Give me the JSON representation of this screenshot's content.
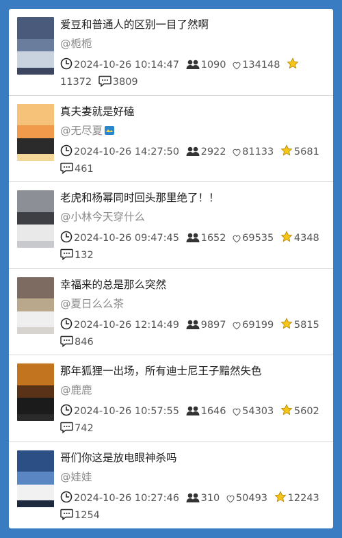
{
  "posts": [
    {
      "title": "爱豆和普通人的区别一目了然啊",
      "author": "@栀栀",
      "time": "2024-10-26 10:14:47",
      "views": "1090",
      "likes": "134148",
      "stars": "11372",
      "comments": "3809",
      "thumb_colors": [
        "#4a5a7a",
        "#6b7d9c",
        "#c9d3e0",
        "#3c4660"
      ]
    },
    {
      "title": "真夫妻就是好磕",
      "author": "@无尽夏",
      "author_badge": true,
      "time": "2024-10-26 14:27:50",
      "views": "2922",
      "likes": "81133",
      "stars": "5681",
      "comments": "461",
      "thumb_colors": [
        "#f6c27a",
        "#f29a4c",
        "#2b2b2b",
        "#f5d79a"
      ]
    },
    {
      "title": "老虎和杨幂同时回头那里绝了！！",
      "author": "@小林今天穿什么",
      "time": "2024-10-26 09:47:45",
      "views": "1652",
      "likes": "69535",
      "stars": "4348",
      "comments": "132",
      "thumb_colors": [
        "#8c8f96",
        "#3d3f45",
        "#e9e9ea",
        "#c7c9cd"
      ]
    },
    {
      "title": "幸福来的总是那么突然",
      "author": "@夏日么么茶",
      "time": "2024-10-26 12:14:49",
      "views": "9897",
      "likes": "69199",
      "stars": "5815",
      "comments": "846",
      "thumb_colors": [
        "#7d6a60",
        "#b9a88c",
        "#efefef",
        "#d7d3cf"
      ]
    },
    {
      "title": "那年狐狸一出场，所有迪士尼王子黯然失色",
      "author": "@鹿鹿",
      "time": "2024-10-26 10:57:55",
      "views": "1646",
      "likes": "54303",
      "stars": "5602",
      "comments": "742",
      "thumb_colors": [
        "#c3741f",
        "#5a3217",
        "#1b1b1b",
        "#2a2a2a"
      ]
    },
    {
      "title": "哥们你这是放电眼神杀吗",
      "author": "@娃娃",
      "time": "2024-10-26 10:27:46",
      "views": "310",
      "likes": "50493",
      "stars": "12243",
      "comments": "1254",
      "thumb_colors": [
        "#2c4f86",
        "#5a87c4",
        "#f1f1f1",
        "#1d2a3f"
      ]
    }
  ],
  "icons": {
    "time": "clock-icon",
    "views": "viewers-icon",
    "likes": "heart-icon",
    "stars": "star-icon",
    "comments": "comment-icon"
  },
  "colors": {
    "background": "#3a7cc2",
    "card": "#ffffff",
    "star": "#f5c518"
  }
}
